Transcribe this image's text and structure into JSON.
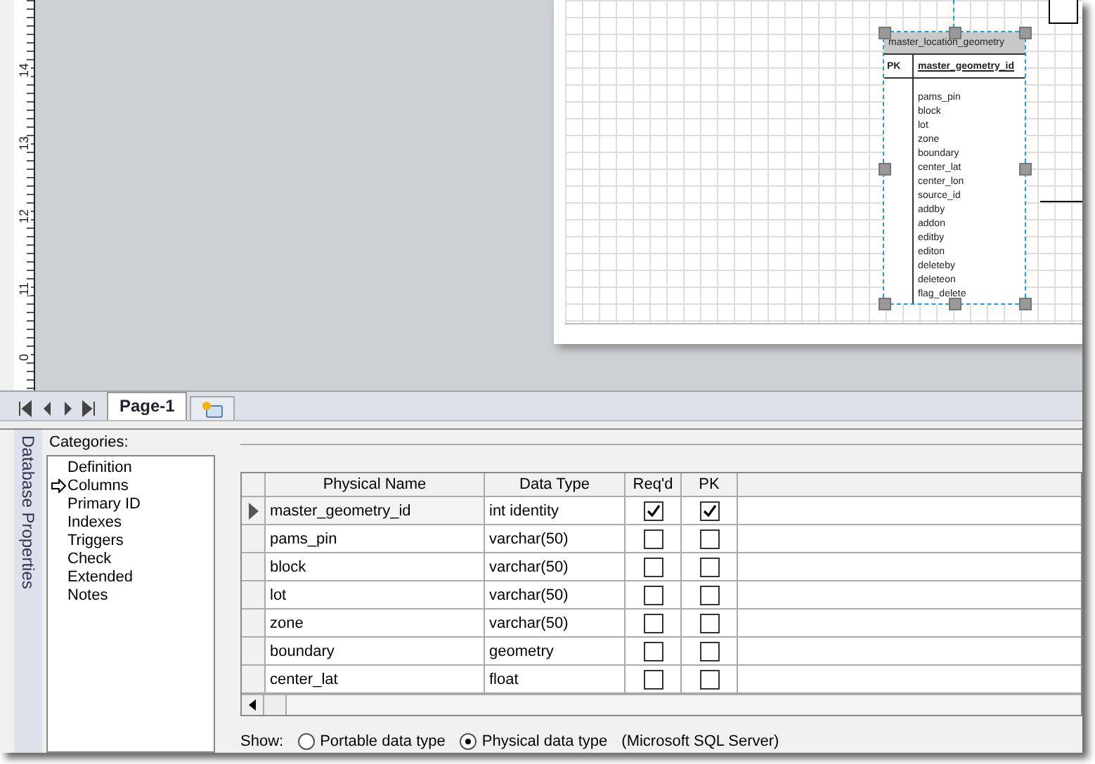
{
  "ruler": {
    "marks": [
      "14",
      "13",
      "12",
      "11",
      "0"
    ]
  },
  "diagram": {
    "entity": {
      "title": "master_location_geometry",
      "key_label": "PK",
      "key_field": "master_geometry_id",
      "selected": true,
      "fields": [
        "pams_pin",
        "block",
        "lot",
        "zone",
        "boundary",
        "center_lat",
        "center_lon",
        "source_id",
        "addby",
        "addon",
        "editby",
        "editon",
        "deleteby",
        "deleteon",
        "flag_delete"
      ]
    }
  },
  "page_tabs": [
    {
      "label": "Page-1",
      "selected": true
    }
  ],
  "properties_panel": {
    "title": "Database Properties",
    "categories_label": "Categories:",
    "categories": [
      {
        "label": "Definition",
        "selected": false
      },
      {
        "label": "Columns",
        "selected": true
      },
      {
        "label": "Primary ID",
        "selected": false
      },
      {
        "label": "Indexes",
        "selected": false
      },
      {
        "label": "Triggers",
        "selected": false
      },
      {
        "label": "Check",
        "selected": false
      },
      {
        "label": "Extended",
        "selected": false
      },
      {
        "label": "Notes",
        "selected": false
      }
    ],
    "grid": {
      "columns": [
        "Physical Name",
        "Data Type",
        "Req'd",
        "PK"
      ],
      "rows": [
        {
          "name": "master_geometry_id",
          "type": "int identity",
          "required": true,
          "pk": true,
          "selected": true
        },
        {
          "name": "pams_pin",
          "type": "varchar(50)",
          "required": false,
          "pk": false,
          "selected": false
        },
        {
          "name": "block",
          "type": "varchar(50)",
          "required": false,
          "pk": false,
          "selected": false
        },
        {
          "name": "lot",
          "type": "varchar(50)",
          "required": false,
          "pk": false,
          "selected": false
        },
        {
          "name": "zone",
          "type": "varchar(50)",
          "required": false,
          "pk": false,
          "selected": false
        },
        {
          "name": "boundary",
          "type": "geometry",
          "required": false,
          "pk": false,
          "selected": false
        },
        {
          "name": "center_lat",
          "type": "float",
          "required": false,
          "pk": false,
          "selected": false
        }
      ]
    },
    "show": {
      "label": "Show:",
      "options": [
        {
          "label": "Portable data type",
          "selected": false
        },
        {
          "label": "Physical data type",
          "selected": true
        }
      ],
      "note": "(Microsoft SQL Server)"
    }
  }
}
